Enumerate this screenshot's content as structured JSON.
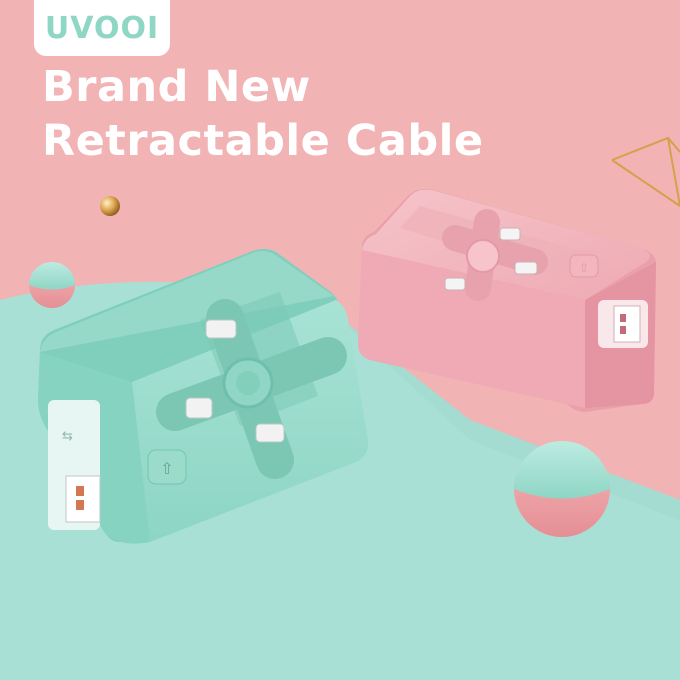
{
  "brand": {
    "logo_text": "UVOOI"
  },
  "headline": {
    "line1": "Brand New",
    "line2": "Retractable Cable"
  },
  "colors": {
    "pink_background": "#f2b3b5",
    "mint_floor": "#a9e0d6",
    "mint_device": "#8fd6c5",
    "pink_device": "#f0aab5",
    "gold_accent": "#d4a14a",
    "white": "#ffffff"
  },
  "icons": [
    "cable-arrow-icon",
    "usb-icon"
  ]
}
